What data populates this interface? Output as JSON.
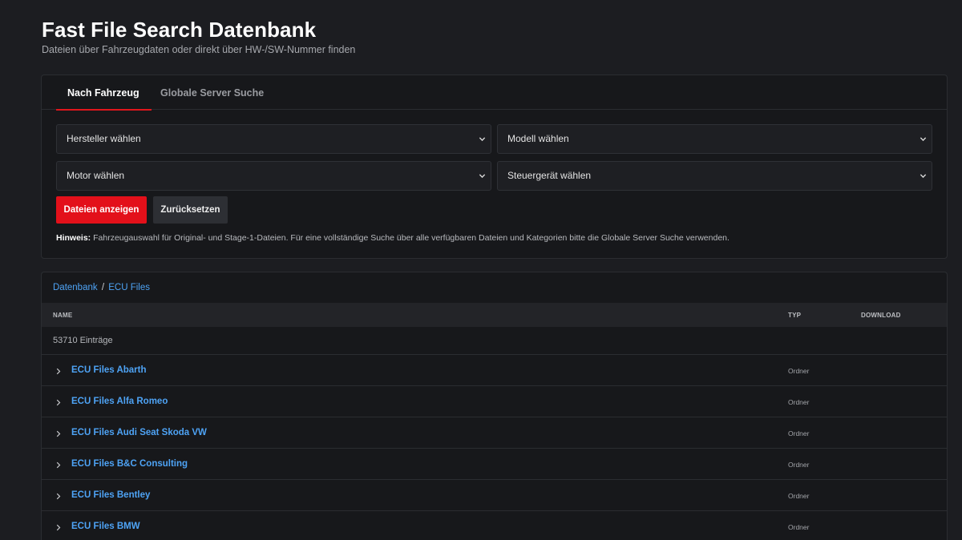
{
  "header": {
    "title": "Fast File Search Datenbank",
    "subtitle": "Dateien über Fahrzeugdaten oder direkt über HW-/SW-Nummer finden"
  },
  "tabs": [
    {
      "label": "Nach Fahrzeug",
      "active": true
    },
    {
      "label": "Globale Server Suche",
      "active": false
    }
  ],
  "filters": {
    "manufacturer": "Hersteller wählen",
    "model": "Modell wählen",
    "engine": "Motor wählen",
    "ecu": "Steuergerät wählen"
  },
  "buttons": {
    "show_files": "Dateien anzeigen",
    "reset": "Zurücksetzen"
  },
  "hint": {
    "label": "Hinweis:",
    "text": " Fahrzeugauswahl für Original- und Stage-1-Dateien. Für eine vollständige Suche über alle verfügbaren Dateien und Kategorien bitte die Globale Server Suche verwenden."
  },
  "breadcrumb": {
    "root": "Datenbank",
    "separator": "/",
    "current": "ECU Files"
  },
  "table": {
    "columns": {
      "name": "NAME",
      "type": "TYP",
      "download": "DOWNLOAD"
    },
    "count": "53710 Einträge",
    "rows": [
      {
        "name": "ECU Files Abarth",
        "type": "Ordner"
      },
      {
        "name": "ECU Files Alfa Romeo",
        "type": "Ordner"
      },
      {
        "name": "ECU Files Audi Seat Skoda VW",
        "type": "Ordner"
      },
      {
        "name": "ECU Files B&C Consulting",
        "type": "Ordner"
      },
      {
        "name": "ECU Files Bentley",
        "type": "Ordner"
      },
      {
        "name": "ECU Files BMW",
        "type": "Ordner"
      }
    ]
  },
  "colors": {
    "background": "#1c1d21",
    "card": "#17181b",
    "accent_red": "#e3101a",
    "link_blue": "#4ea3f5"
  },
  "icons": {
    "select_chevron": "chevron-down-icon",
    "row_expand": "chevron-right-icon"
  }
}
